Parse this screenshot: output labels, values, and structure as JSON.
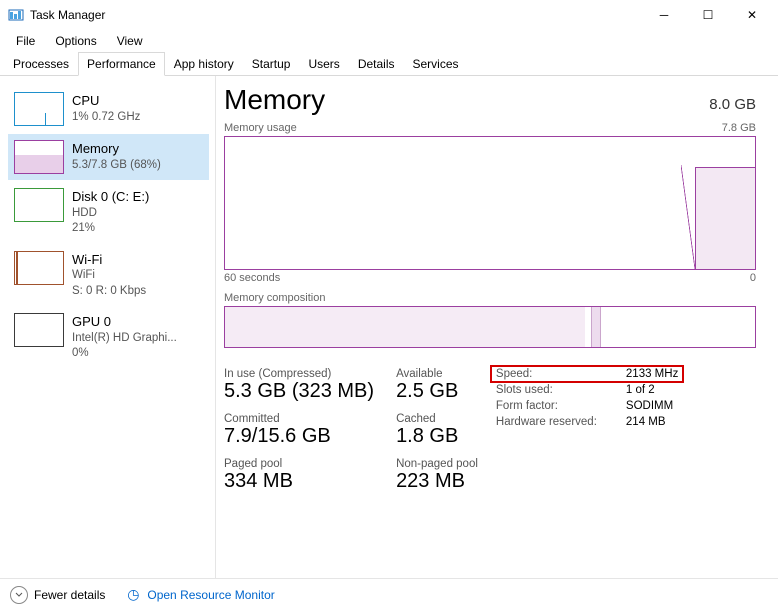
{
  "window": {
    "title": "Task Manager"
  },
  "menu": {
    "file": "File",
    "options": "Options",
    "view": "View"
  },
  "tabs": {
    "processes": "Processes",
    "performance": "Performance",
    "apphistory": "App history",
    "startup": "Startup",
    "users": "Users",
    "details": "Details",
    "services": "Services"
  },
  "sidebar": {
    "cpu": {
      "title": "CPU",
      "sub": "1% 0.72 GHz"
    },
    "mem": {
      "title": "Memory",
      "sub": "5.3/7.8 GB (68%)"
    },
    "disk": {
      "title": "Disk 0 (C: E:)",
      "sub1": "HDD",
      "sub2": "21%"
    },
    "wifi": {
      "title": "Wi-Fi",
      "sub1": "WiFi",
      "sub2": "S: 0  R: 0 Kbps"
    },
    "gpu": {
      "title": "GPU 0",
      "sub1": "Intel(R) HD Graphi...",
      "sub2": "0%"
    }
  },
  "detail": {
    "title": "Memory",
    "capacity": "8.0 GB",
    "chart1": {
      "label": "Memory usage",
      "max": "7.8 GB",
      "x_left": "60 seconds",
      "x_right": "0"
    },
    "chart2": {
      "label": "Memory composition"
    },
    "stats": {
      "inuse_lbl": "In use (Compressed)",
      "inuse_val": "5.3 GB (323 MB)",
      "available_lbl": "Available",
      "available_val": "2.5 GB",
      "committed_lbl": "Committed",
      "committed_val": "7.9/15.6 GB",
      "cached_lbl": "Cached",
      "cached_val": "1.8 GB",
      "paged_lbl": "Paged pool",
      "paged_val": "334 MB",
      "nonpaged_lbl": "Non-paged pool",
      "nonpaged_val": "223 MB"
    },
    "hw": {
      "speed_lbl": "Speed:",
      "speed_val": "2133 MHz",
      "slots_lbl": "Slots used:",
      "slots_val": "1 of 2",
      "form_lbl": "Form factor:",
      "form_val": "SODIMM",
      "reserved_lbl": "Hardware reserved:",
      "reserved_val": "214 MB"
    }
  },
  "footer": {
    "fewer": "Fewer details",
    "resmon": "Open Resource Monitor"
  },
  "chart_data": {
    "type": "line",
    "title": "Memory usage",
    "xlabel": "seconds",
    "ylabel": "GB",
    "ylim": [
      0,
      7.8
    ],
    "x": [
      60,
      8,
      5,
      0
    ],
    "values": [
      0,
      0,
      5.3,
      5.3
    ]
  }
}
